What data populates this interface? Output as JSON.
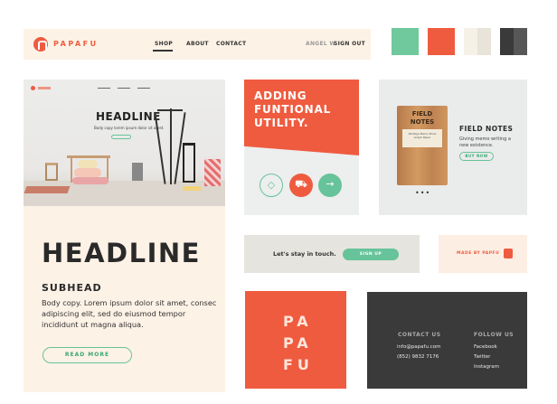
{
  "navbar": {
    "brand": "PAPAFU",
    "items": [
      "SHOP",
      "ABOUT",
      "CONTACT"
    ],
    "user": "ANGEL W",
    "signout": "SIGN OUT"
  },
  "swatches": [
    "#6fc99d",
    "#ef5b3f",
    "#f4efe5",
    "#3a3a3a"
  ],
  "hero": {
    "mini_headline": "HEADLINE",
    "mini_copy": "Body copy lorem ipsum dolor sit amet.",
    "headline": "HEADLINE",
    "subhead": "SUBHEAD",
    "body": "Body copy. Lorem ipsum dolor sit amet, consec adipiscing elit, sed do eiusmod tempor incididunt ut magna aliqua.",
    "button": "READ MORE"
  },
  "adding": {
    "title": "ADDING FUNTIONAL UTILITY.",
    "icons": [
      "diamond-icon",
      "cart-icon",
      "arrow-right-icon"
    ]
  },
  "notes": {
    "notebook_label": "FIELD NOTES",
    "notebook_card": "48-Page Memo Book Graph Paper",
    "title": "FIELD NOTES",
    "description": "Giving memo writing a new existence.",
    "button": "BUY NOW",
    "dots": "•••"
  },
  "newsletter": {
    "text": "Let's stay in touch.",
    "button": "SIGN UP"
  },
  "made_by": {
    "text": "MADE BY PAPFU"
  },
  "papafu": [
    "PA",
    "PA",
    "FU"
  ],
  "contact": {
    "contact_heading": "CONTACT US",
    "email": "info@papafu.com",
    "phone": "(852) 9832 7176",
    "follow_heading": "FOLLOW US",
    "links": [
      "Facebook",
      "Twitter",
      "Instagram"
    ]
  }
}
